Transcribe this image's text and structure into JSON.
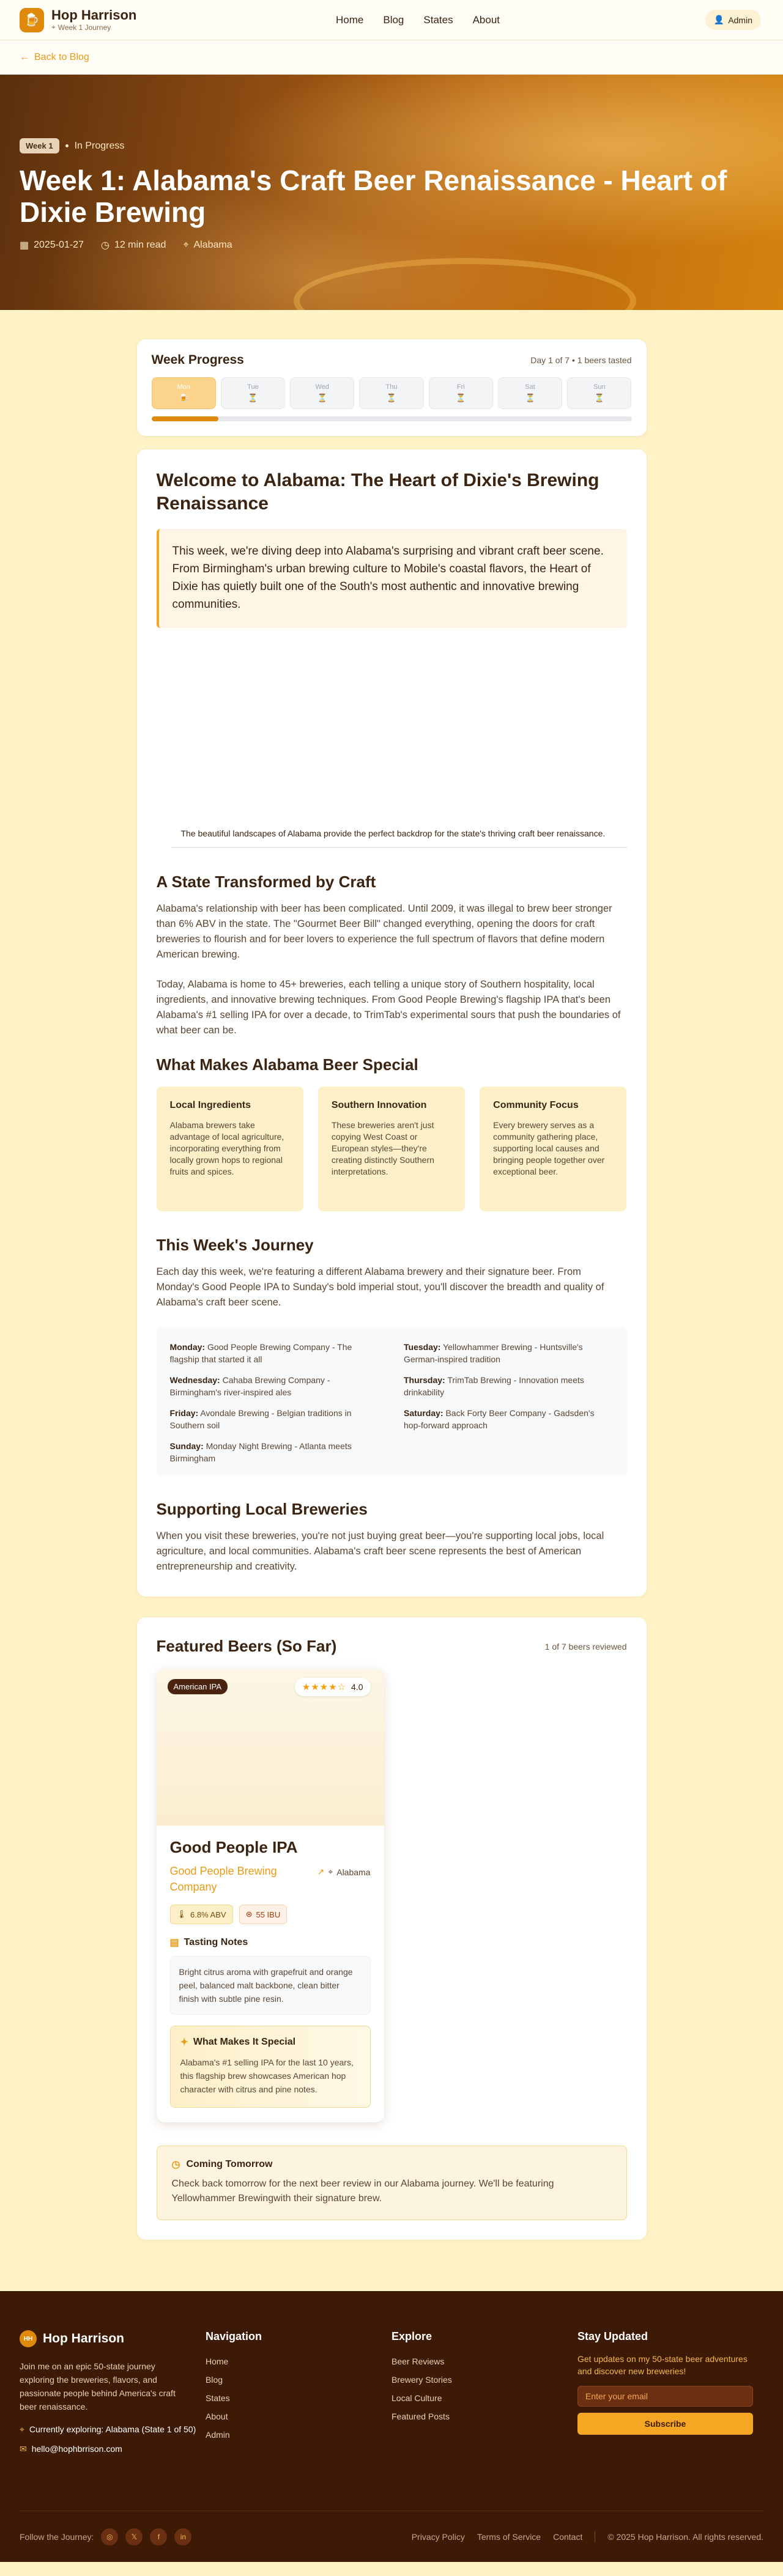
{
  "header": {
    "brand_name": "Hop Harrison",
    "brand_sub": "Week 1 Journey",
    "nav": [
      "Home",
      "Blog",
      "States",
      "About"
    ],
    "admin_label": "Admin"
  },
  "back_label": "Back to Blog",
  "hero": {
    "week_pill": "Week 1",
    "status": "In Progress",
    "title": "Week 1: Alabama's Craft Beer Renaissance - Heart of Dixie Brewing",
    "date": "2025-01-27",
    "read_time": "12 min read",
    "location": "Alabama"
  },
  "progress": {
    "title": "Week Progress",
    "count_text": "Day 1 of 7 • 1 beers tasted",
    "fraction": 0.14,
    "days": [
      "Mon",
      "Tue",
      "Wed",
      "Thu",
      "Fri",
      "Sat",
      "Sun"
    ]
  },
  "article": {
    "title": "Welcome to Alabama: The Heart of Dixie's Brewing Renaissance",
    "lead": "This week, we're diving deep into Alabama's surprising and vibrant craft beer scene. From Birmingham's urban brewing culture to Mobile's coastal flavors, the Heart of Dixie has quietly built one of the South's most authentic and innovative brewing communities.",
    "photo_caption": "The beautiful landscapes of Alabama provide the perfect backdrop for the state's thriving craft beer renaissance.",
    "h2_state": "A State Transformed by Craft",
    "p_state_1": "Alabama's relationship with beer has been complicated. Until 2009, it was illegal to brew beer stronger than 6% ABV in the state. The \"Gourmet Beer Bill\" changed everything, opening the doors for craft breweries to flourish and for beer lovers to experience the full spectrum of flavors that define modern American brewing.",
    "p_state_2": "Today, Alabama is home to 45+ breweries, each telling a unique story of Southern hospitality, local ingredients, and innovative brewing techniques. From Good People Brewing's flagship IPA that's been Alabama's #1 selling IPA for over a decade, to TrimTab's experimental sours that push the boundaries of what beer can be.",
    "h2_special": "What Makes Alabama Beer Special",
    "features": [
      {
        "title": "Local Ingredients",
        "desc": "Alabama brewers take advantage of local agriculture, incorporating everything from locally grown hops to regional fruits and spices."
      },
      {
        "title": "Southern Innovation",
        "desc": "These breweries aren't just copying West Coast or European styles—they're creating distinctly Southern interpretations."
      },
      {
        "title": "Community Focus",
        "desc": "Every brewery serves as a community gathering place, supporting local causes and bringing people together over exceptional beer."
      }
    ],
    "h2_journey": "This Week's Journey",
    "p_journey": "Each day this week, we're featuring a different Alabama brewery and their signature beer. From Monday's Good People IPA to Sunday's bold imperial stout, you'll discover the breadth and quality of Alabama's craft beer scene.",
    "schedule": [
      {
        "day": "Monday:",
        "text": "Good People Brewing Company - The flagship that started it all"
      },
      {
        "day": "Tuesday:",
        "text": "Yellowhammer Brewing - Huntsville's German-inspired tradition"
      },
      {
        "day": "Wednesday:",
        "text": "Cahaba Brewing Company - Birmingham's river-inspired ales"
      },
      {
        "day": "Thursday:",
        "text": "TrimTab Brewing - Innovation meets drinkability"
      },
      {
        "day": "Friday:",
        "text": "Avondale Brewing - Belgian traditions in Southern soil"
      },
      {
        "day": "Saturday:",
        "text": "Back Forty Beer Company - Gadsden's hop-forward approach"
      },
      {
        "day": "Sunday:",
        "text": "Monday Night Brewing - Atlanta meets Birmingham"
      }
    ],
    "h2_support": "Supporting Local Breweries",
    "p_support": "When you visit these breweries, you're not just buying great beer—you're supporting local jobs, local agriculture, and local communities. Alabama's craft beer scene represents the best of American entrepreneurship and creativity."
  },
  "beers": {
    "title": "Featured Beers (So Far)",
    "count_text": "1 of 7 beers reviewed",
    "card": {
      "style": "American IPA",
      "rating": "4.0",
      "rating_value": 4,
      "name": "Good People IPA",
      "brewery": "Good People Brewing Company",
      "location": "Alabama",
      "abv": "6.8% ABV",
      "ibu": "55 IBU",
      "notes_title": "Tasting Notes",
      "notes": "Bright citrus aroma with grapefruit and orange peel, balanced malt backbone, clean bitter finish with subtle pine resin.",
      "special_title": "What Makes It Special",
      "special_text": "Alabama's #1 selling IPA for the last 10 years, this flagship brew showcases American hop character with citrus and pine notes."
    },
    "coming_title": "Coming Tomorrow",
    "coming_text": "Check back tomorrow for the next beer review in our Alabama journey. We'll be featuring Yellowhammer Brewingwith their signature brew."
  },
  "footer": {
    "brand": "Hop Harrison",
    "logo_text": "HH",
    "desc": "Join me on an epic 50-state journey exploring the breweries, flavors, and passionate people behind America's craft beer renaissance.",
    "exploring": "Currently exploring: Alabama (State 1 of 50)",
    "email": "hello@hophbrrison.com",
    "nav_title": "Navigation",
    "nav_items": [
      "Home",
      "Blog",
      "States",
      "About",
      "Admin"
    ],
    "explore_title": "Explore",
    "explore_items": [
      "Beer Reviews",
      "Brewery Stories",
      "Local Culture",
      "Featured Posts"
    ],
    "stay_title": "Stay Updated",
    "stay_desc": "Get updates on my 50-state beer adventures and discover new breweries!",
    "email_placeholder": "Enter your email",
    "subscribe": "Subscribe",
    "follow": "Follow the Journey:",
    "bottom_links": [
      "Privacy Policy",
      "Terms of Service",
      "Contact"
    ],
    "copyright": "© 2025 Hop Harrison. All rights reserved."
  }
}
